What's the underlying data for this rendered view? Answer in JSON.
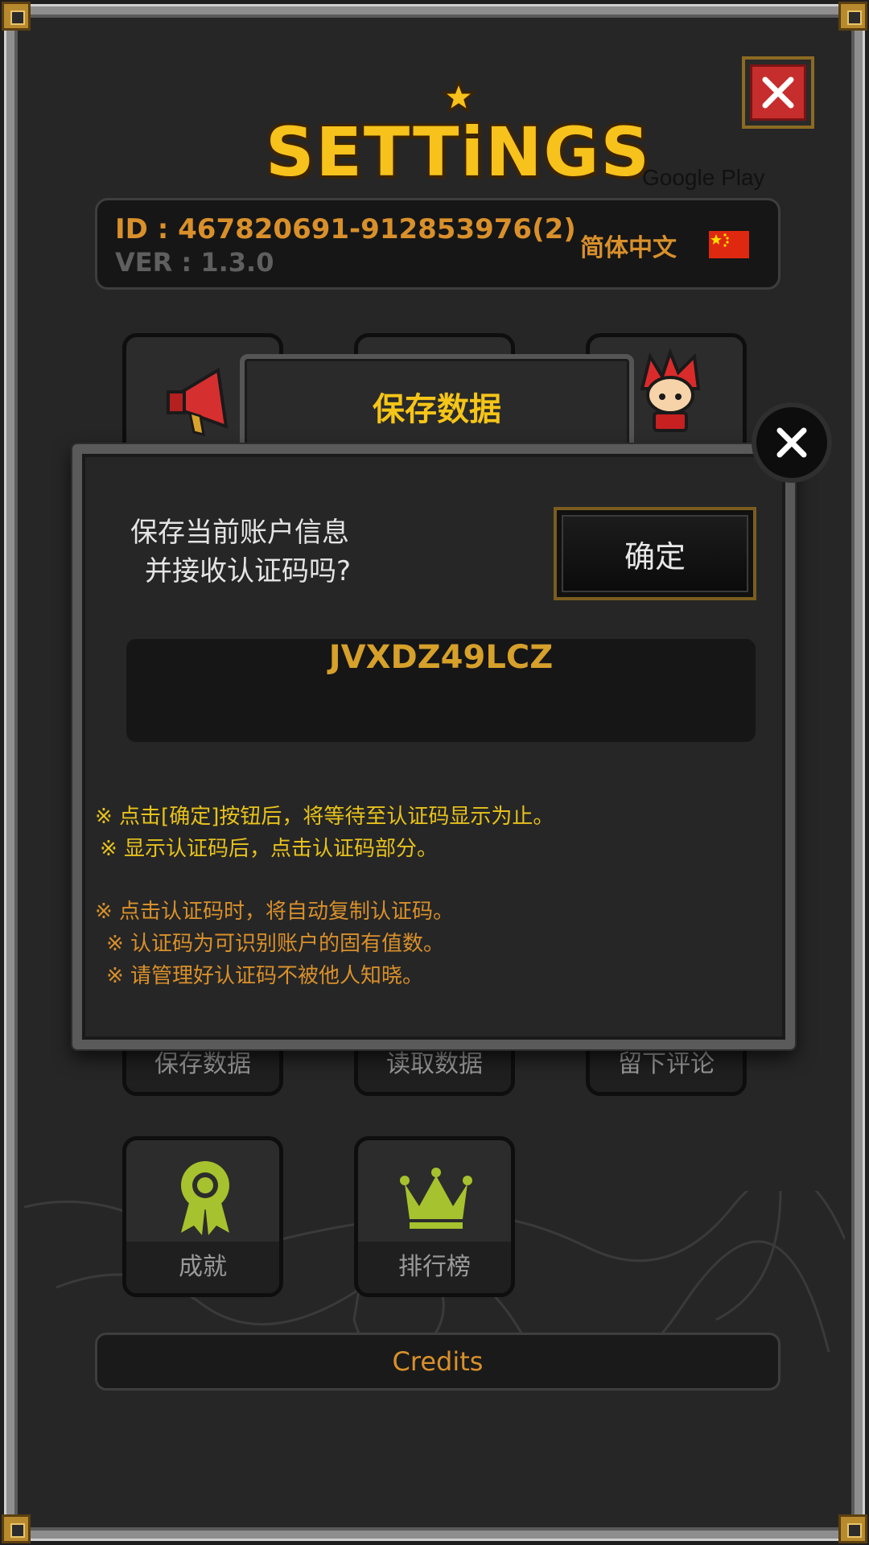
{
  "header": {
    "logo_text": "SETTiNGS",
    "store_label": "Google Play"
  },
  "account": {
    "id": "ID : 467820691-912853976(2)",
    "version": "VER : 1.3.0",
    "language": "简体中文"
  },
  "tiles": {
    "save_data": "保存数据",
    "load_data": "读取数据",
    "leave_review": "留下评论",
    "achievements": "成就",
    "leaderboard": "排行榜"
  },
  "credits": "Credits",
  "dialog": {
    "title": "保存数据",
    "question_line1": "保存当前账户信息",
    "question_line2": "并接收认证码吗?",
    "confirm_label": "确定",
    "auth_code": "JVXDZ49LCZ",
    "notes": [
      "※ 点击[确定]按钮后，将等待至认证码显示为止。",
      "※ 显示认证码后，点击认证码部分。",
      "※ 点击认证码时，将自动复制认证码。",
      "※ 认证码为可识别账户的固有值数。",
      "※ 请管理好认证码不被他人知晓。"
    ]
  },
  "colors": {
    "gold": "#f5c518",
    "orange": "#d9902b",
    "close_red": "#c62d2d",
    "icon_green": "#a6c22e"
  }
}
